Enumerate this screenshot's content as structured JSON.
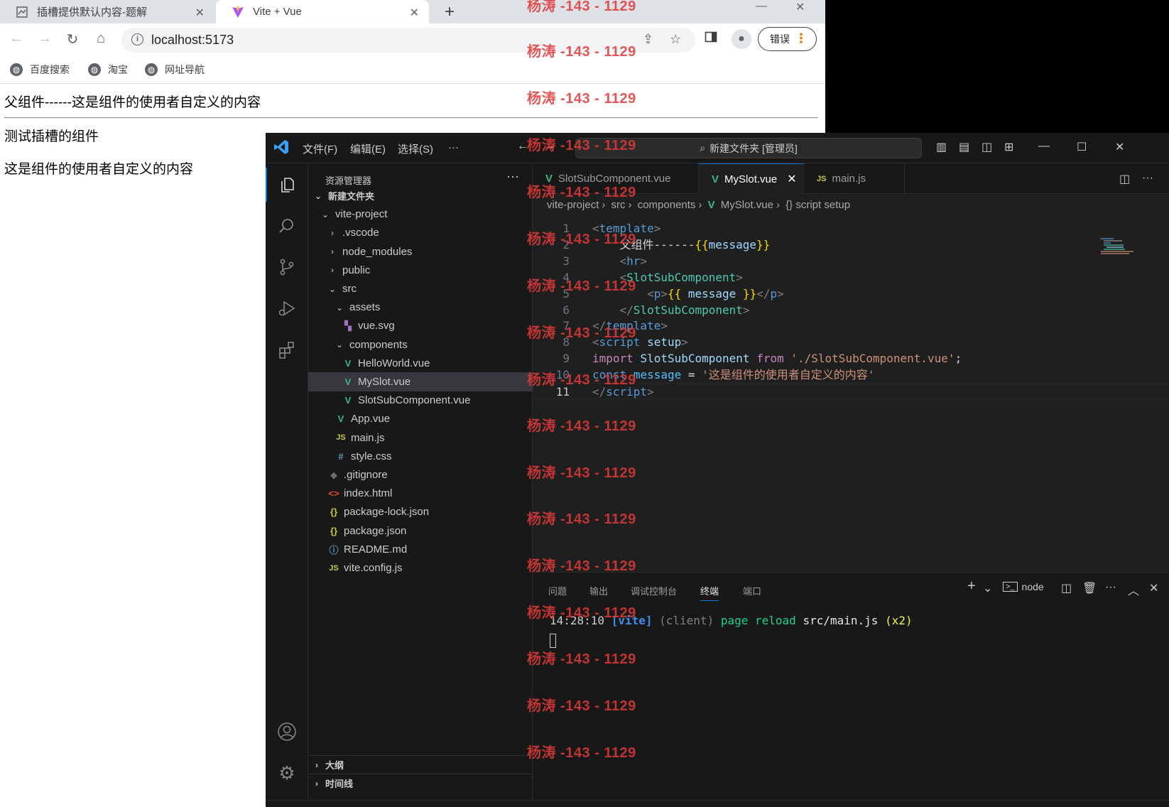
{
  "browser": {
    "tabs": [
      {
        "title": "插槽提供默认内容-题解",
        "icon": "doc-icon"
      },
      {
        "title": "Vite + Vue",
        "icon": "vite-icon"
      }
    ],
    "address": "localhost:5173",
    "error_button": "错误",
    "bookmarks": [
      "百度搜索",
      "淘宝",
      "网址导航"
    ],
    "page": {
      "line1": "父组件------这是组件的使用者自定义的内容",
      "line2": "测试插槽的组件",
      "line3": "这是组件的使用者自定义的内容"
    }
  },
  "vscode": {
    "menu": [
      "文件(F)",
      "编辑(E)",
      "选择(S)",
      "···"
    ],
    "search": "新建文件夹 [管理员]",
    "explorer_title": "资源管理器",
    "tree": [
      {
        "label": "新建文件夹",
        "depth": 0,
        "type": "folder-open",
        "bold": true
      },
      {
        "label": "vite-project",
        "depth": 1,
        "type": "folder-open"
      },
      {
        "label": ".vscode",
        "depth": 2,
        "type": "folder"
      },
      {
        "label": "node_modules",
        "depth": 2,
        "type": "folder"
      },
      {
        "label": "public",
        "depth": 2,
        "type": "folder"
      },
      {
        "label": "src",
        "depth": 2,
        "type": "folder-open"
      },
      {
        "label": "assets",
        "depth": 3,
        "type": "folder-open"
      },
      {
        "label": "vue.svg",
        "depth": 4,
        "type": "svg"
      },
      {
        "label": "components",
        "depth": 3,
        "type": "folder-open"
      },
      {
        "label": "HelloWorld.vue",
        "depth": 4,
        "type": "vue"
      },
      {
        "label": "MySlot.vue",
        "depth": 4,
        "type": "vue",
        "selected": true
      },
      {
        "label": "SlotSubComponent.vue",
        "depth": 4,
        "type": "vue"
      },
      {
        "label": "App.vue",
        "depth": 3,
        "type": "vue"
      },
      {
        "label": "main.js",
        "depth": 3,
        "type": "js"
      },
      {
        "label": "style.css",
        "depth": 3,
        "type": "css"
      },
      {
        "label": ".gitignore",
        "depth": 2,
        "type": "git"
      },
      {
        "label": "index.html",
        "depth": 2,
        "type": "html"
      },
      {
        "label": "package-lock.json",
        "depth": 2,
        "type": "json"
      },
      {
        "label": "package.json",
        "depth": 2,
        "type": "json"
      },
      {
        "label": "README.md",
        "depth": 2,
        "type": "md"
      },
      {
        "label": "vite.config.js",
        "depth": 2,
        "type": "js"
      }
    ],
    "outline_label": "大纲",
    "timeline_label": "时间线",
    "editor_tabs": [
      {
        "label": "SlotSubComponent.vue",
        "type": "vue"
      },
      {
        "label": "MySlot.vue",
        "type": "vue",
        "active": true
      },
      {
        "label": "main.js",
        "type": "js"
      }
    ],
    "breadcrumb": [
      "vite-project",
      "src",
      "components",
      "MySlot.vue",
      "{} script setup"
    ],
    "code_lines": [
      [
        [
          "t-punct",
          "<"
        ],
        [
          "t-tag",
          "template"
        ],
        [
          "t-punct",
          ">"
        ]
      ],
      [
        [
          "t-text",
          "    父组件------"
        ],
        [
          "t-brace",
          "{{"
        ],
        [
          "t-var",
          "message"
        ],
        [
          "t-brace",
          "}}"
        ]
      ],
      [
        [
          "t-text",
          "    "
        ],
        [
          "t-punct",
          "<"
        ],
        [
          "t-tag",
          "hr"
        ],
        [
          "t-punct",
          ">"
        ]
      ],
      [
        [
          "t-text",
          "    "
        ],
        [
          "t-punct",
          "<"
        ],
        [
          "t-comp",
          "SlotSubComponent"
        ],
        [
          "t-punct",
          ">"
        ]
      ],
      [
        [
          "t-text",
          "        "
        ],
        [
          "t-punct",
          "<"
        ],
        [
          "t-tag",
          "p"
        ],
        [
          "t-punct",
          ">"
        ],
        [
          "t-brace",
          "{{"
        ],
        [
          "t-var",
          " message "
        ],
        [
          "t-brace",
          "}}"
        ],
        [
          "t-punct",
          "</"
        ],
        [
          "t-tag",
          "p"
        ],
        [
          "t-punct",
          ">"
        ]
      ],
      [
        [
          "t-text",
          "    "
        ],
        [
          "t-punct",
          "</"
        ],
        [
          "t-comp",
          "SlotSubComponent"
        ],
        [
          "t-punct",
          ">"
        ]
      ],
      [
        [
          "t-punct",
          "</"
        ],
        [
          "t-tag",
          "template"
        ],
        [
          "t-punct",
          ">"
        ]
      ],
      [
        [
          "t-punct",
          "<"
        ],
        [
          "t-tag",
          "script"
        ],
        [
          "t-text",
          " "
        ],
        [
          "t-attr",
          "setup"
        ],
        [
          "t-punct",
          ">"
        ]
      ],
      [
        [
          "t-kw",
          "import"
        ],
        [
          "t-text",
          " "
        ],
        [
          "t-var",
          "SlotSubComponent"
        ],
        [
          "t-text",
          " "
        ],
        [
          "t-kw",
          "from"
        ],
        [
          "t-text",
          " "
        ],
        [
          "t-str",
          "'./SlotSubComponent.vue'"
        ],
        [
          "t-text",
          ";"
        ]
      ],
      [
        [
          "t-kw2",
          "const"
        ],
        [
          "t-text",
          " "
        ],
        [
          "t-var2",
          "message"
        ],
        [
          "t-text",
          " = "
        ],
        [
          "t-str",
          "'这是组件的使用者自定义的内容'"
        ]
      ],
      [
        [
          "t-punct",
          "</"
        ],
        [
          "t-tag",
          "script"
        ],
        [
          "t-punct",
          ">"
        ]
      ]
    ],
    "current_line": 11,
    "panel_tabs": [
      "问题",
      "输出",
      "调试控制台",
      "终端",
      "端口"
    ],
    "active_panel_tab": "终端",
    "terminal_shell": "node",
    "terminal": {
      "time": "14:28:10",
      "tag": "[vite]",
      "scope": "(client)",
      "action": "page reload",
      "file": "src/main.js",
      "count": "(x2)"
    }
  },
  "watermark": "杨涛 -143 - 1129",
  "colors": {
    "accent": "#0078d4",
    "watermark": "#e03a3a",
    "vue_green": "#41b883"
  }
}
